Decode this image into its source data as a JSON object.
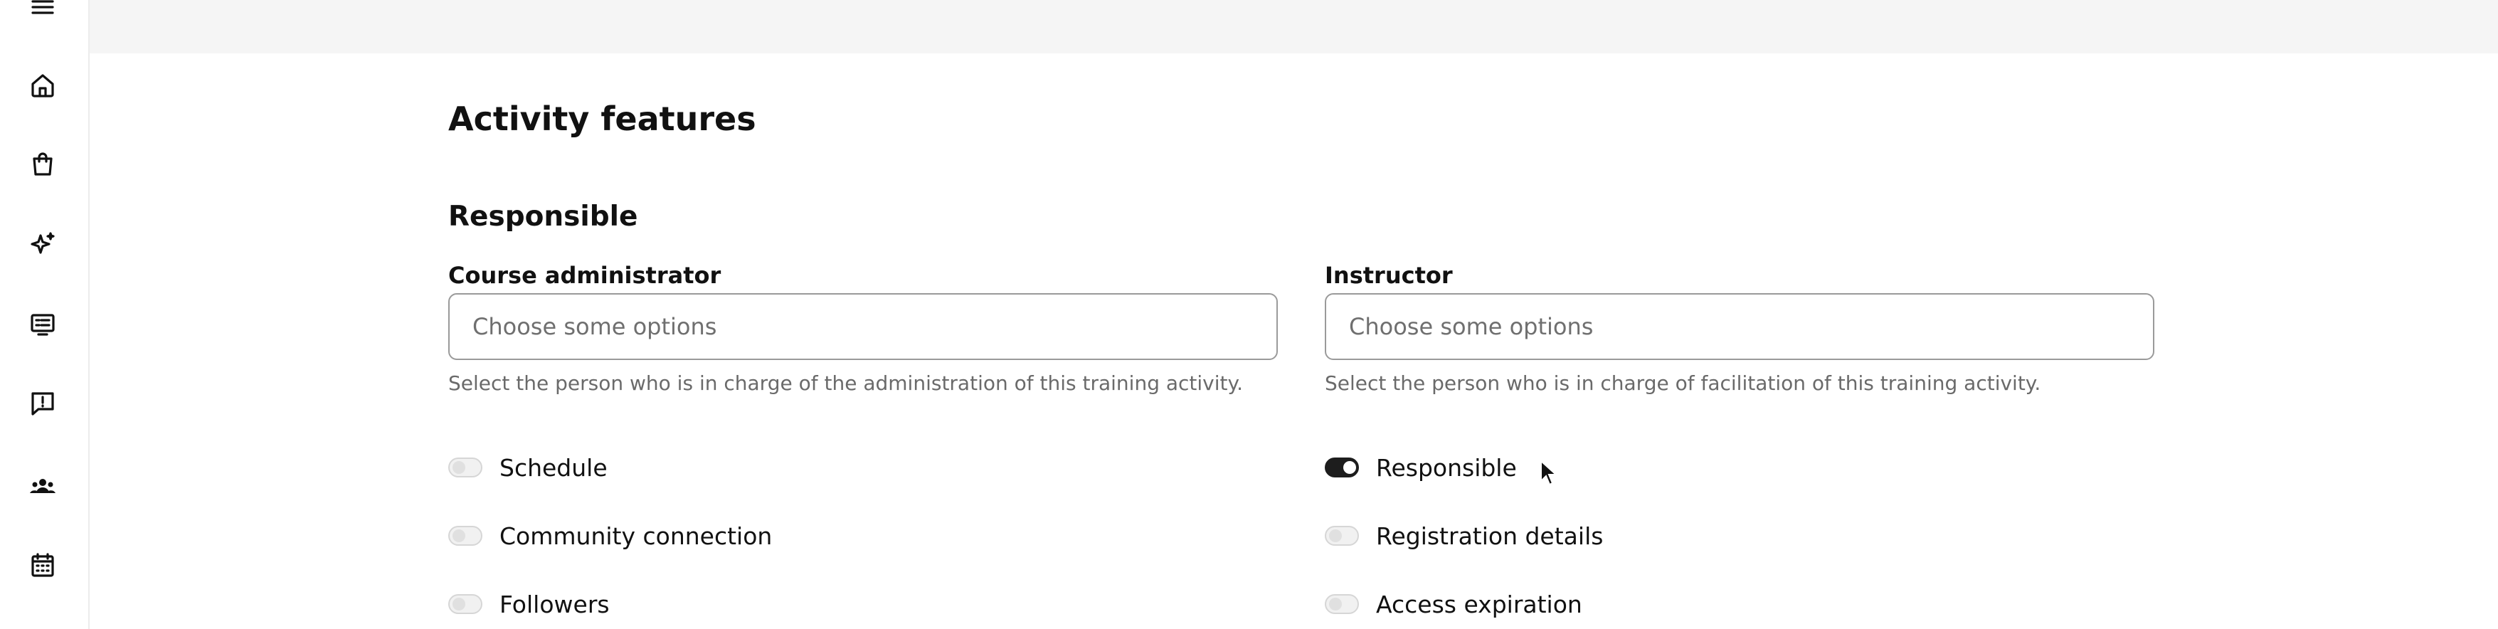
{
  "sidebar": {
    "icons": [
      "menu-icon",
      "home-icon",
      "shopping-bag-icon",
      "sparkles-icon",
      "presentation-icon",
      "feedback-icon",
      "users-icon",
      "calendar-icon"
    ]
  },
  "page": {
    "title": "Activity features",
    "section": "Responsible"
  },
  "fields": {
    "admin": {
      "label": "Course administrator",
      "placeholder": "Choose some options",
      "help": "Select the person who is in charge of the administration of this training activity."
    },
    "instructor": {
      "label": "Instructor",
      "placeholder": "Choose some options",
      "help": "Select the person who is in charge of facilitation of this training activity."
    }
  },
  "toggles": {
    "left": [
      {
        "label": "Schedule",
        "on": false
      },
      {
        "label": "Community connection",
        "on": false
      },
      {
        "label": "Followers",
        "on": false
      }
    ],
    "right": [
      {
        "label": "Responsible",
        "on": true
      },
      {
        "label": "Registration details",
        "on": false
      },
      {
        "label": "Access expiration",
        "on": false
      }
    ]
  }
}
